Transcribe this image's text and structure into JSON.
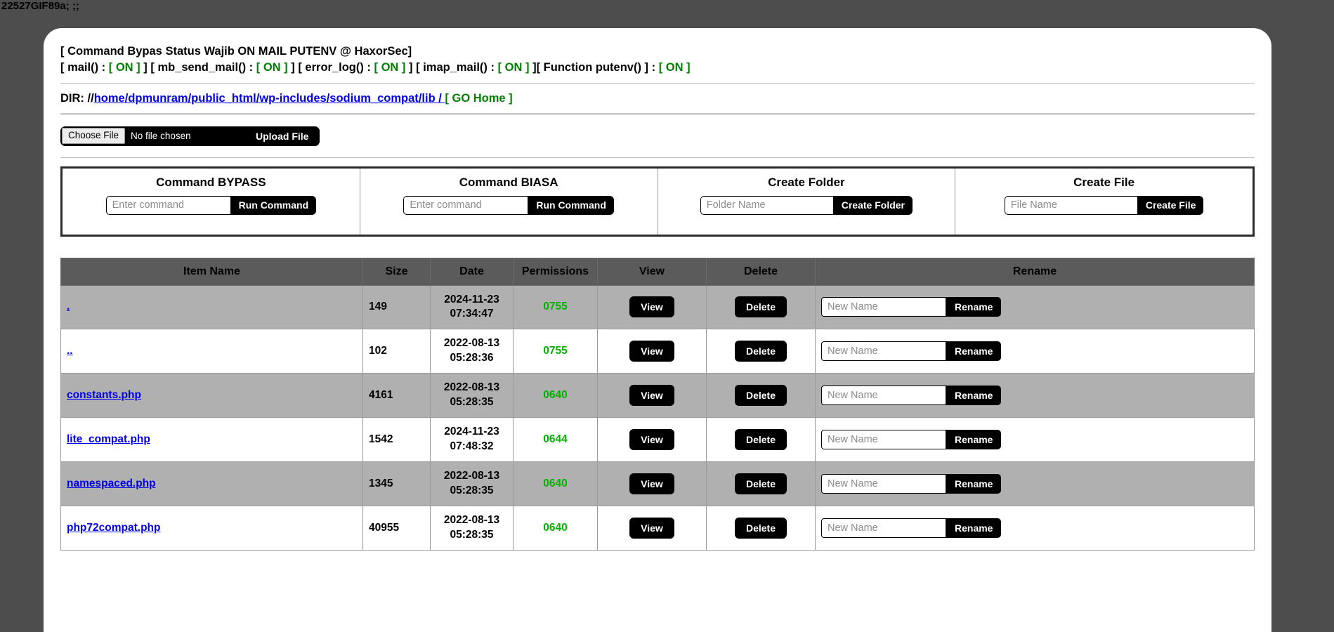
{
  "page": {
    "artifact_text": "22527GIF89a; ;;",
    "background_color": "#4d4d4d"
  },
  "status": {
    "title_prefix": "[ Command Bypas Status Wajib ON MAIL PUTENV @ HaxorSec]",
    "functions": [
      {
        "open": "[ mail() : ",
        "state": "[ ON ]",
        "close": " ]"
      },
      {
        "open": "[ mb_send_mail() : ",
        "state": "[ ON ]",
        "close": " ]"
      },
      {
        "open": "[ error_log() : ",
        "state": "[ ON ]",
        "close": " ]"
      },
      {
        "open": "[ imap_mail() : ",
        "state": "[ ON ]",
        "close": " ]"
      },
      {
        "open": "[ Function putenv() ] : ",
        "state": "[ ON ]",
        "close": ""
      }
    ],
    "on_color": "#008000"
  },
  "dir": {
    "label": "DIR:",
    "prefix": "//",
    "segments": [
      "home",
      "dpmunram",
      "public_html",
      "wp-includes",
      "sodium_compat",
      "lib"
    ],
    "trailing": " / ",
    "go_home": "[ GO Home ]",
    "link_color": "#0000ee",
    "go_home_color": "#008000"
  },
  "upload": {
    "choose_label": "Choose File",
    "no_file_text": "No file chosen",
    "upload_label": "Upload File"
  },
  "panels": [
    {
      "title": "Command BYPASS",
      "input_placeholder": "Enter command",
      "input_value": "",
      "button_label": "Run Command",
      "input_width": "w-cmd"
    },
    {
      "title": "Command BIASA",
      "input_placeholder": "Enter command",
      "input_value": "",
      "button_label": "Run Command",
      "input_width": "w-cmd"
    },
    {
      "title": "Create Folder",
      "input_placeholder": "Folder Name",
      "input_value": "",
      "button_label": "Create Folder",
      "input_width": "w-name"
    },
    {
      "title": "Create File",
      "input_placeholder": "File Name",
      "input_value": "",
      "button_label": "Create File",
      "input_width": "w-name"
    }
  ],
  "table": {
    "headers": [
      "Item Name",
      "Size",
      "Date",
      "Permissions",
      "View",
      "Delete",
      "Rename"
    ],
    "view_label": "View",
    "delete_label": "Delete",
    "rename_label": "Rename",
    "rename_placeholder": "New Name",
    "rows": [
      {
        "name": ".",
        "size": "149",
        "date_d": "2024-11-23",
        "date_t": "07:34:47",
        "perm": "0755"
      },
      {
        "name": "..",
        "size": "102",
        "date_d": "2022-08-13",
        "date_t": "05:28:36",
        "perm": "0755"
      },
      {
        "name": "constants.php",
        "size": "4161",
        "date_d": "2022-08-13",
        "date_t": "05:28:35",
        "perm": "0640"
      },
      {
        "name": "lite_compat.php",
        "size": "1542",
        "date_d": "2024-11-23",
        "date_t": "07:48:32",
        "perm": "0644"
      },
      {
        "name": "namespaced.php",
        "size": "1345",
        "date_d": "2022-08-13",
        "date_t": "05:28:35",
        "perm": "0640"
      },
      {
        "name": "php72compat.php",
        "size": "40955",
        "date_d": "2022-08-13",
        "date_t": "05:28:35",
        "perm": "0640"
      }
    ]
  }
}
